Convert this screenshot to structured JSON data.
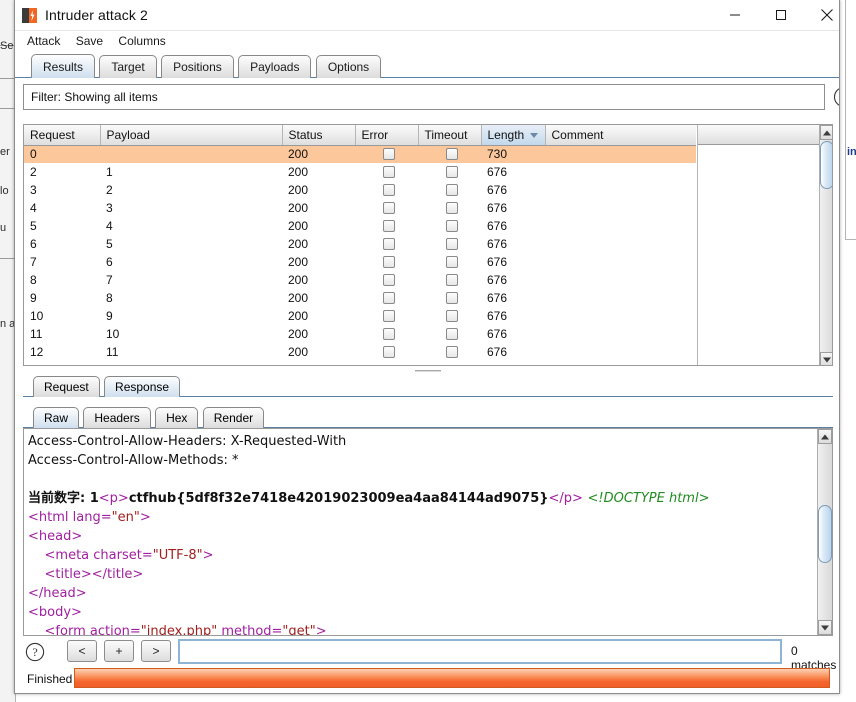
{
  "window": {
    "title": "Intruder attack 2",
    "icon": "burp-logo-icon",
    "controls": {
      "minimize": "minimize-icon",
      "maximize": "maximize-icon",
      "close": "close-icon"
    }
  },
  "menubar": {
    "items": [
      "Attack",
      "Save",
      "Columns"
    ]
  },
  "tabs": {
    "items": [
      "Results",
      "Target",
      "Positions",
      "Payloads",
      "Options"
    ],
    "active": "Results"
  },
  "filter": {
    "text": "Filter: Showing all items",
    "help": "?"
  },
  "results_table": {
    "columns": [
      "Request",
      "Payload",
      "Status",
      "Error",
      "Timeout",
      "Length",
      "Comment"
    ],
    "sorted_column": "Length",
    "sort_direction": "descending",
    "rows": [
      {
        "request": "0",
        "payload": "",
        "status": "200",
        "error": false,
        "timeout": false,
        "length": "730",
        "comment": "",
        "selected": true
      },
      {
        "request": "2",
        "payload": "1",
        "status": "200",
        "error": false,
        "timeout": false,
        "length": "676",
        "comment": "",
        "selected": false
      },
      {
        "request": "3",
        "payload": "2",
        "status": "200",
        "error": false,
        "timeout": false,
        "length": "676",
        "comment": "",
        "selected": false
      },
      {
        "request": "4",
        "payload": "3",
        "status": "200",
        "error": false,
        "timeout": false,
        "length": "676",
        "comment": "",
        "selected": false
      },
      {
        "request": "5",
        "payload": "4",
        "status": "200",
        "error": false,
        "timeout": false,
        "length": "676",
        "comment": "",
        "selected": false
      },
      {
        "request": "6",
        "payload": "5",
        "status": "200",
        "error": false,
        "timeout": false,
        "length": "676",
        "comment": "",
        "selected": false
      },
      {
        "request": "7",
        "payload": "6",
        "status": "200",
        "error": false,
        "timeout": false,
        "length": "676",
        "comment": "",
        "selected": false
      },
      {
        "request": "8",
        "payload": "7",
        "status": "200",
        "error": false,
        "timeout": false,
        "length": "676",
        "comment": "",
        "selected": false
      },
      {
        "request": "9",
        "payload": "8",
        "status": "200",
        "error": false,
        "timeout": false,
        "length": "676",
        "comment": "",
        "selected": false
      },
      {
        "request": "10",
        "payload": "9",
        "status": "200",
        "error": false,
        "timeout": false,
        "length": "676",
        "comment": "",
        "selected": false
      },
      {
        "request": "11",
        "payload": "10",
        "status": "200",
        "error": false,
        "timeout": false,
        "length": "676",
        "comment": "",
        "selected": false
      },
      {
        "request": "12",
        "payload": "11",
        "status": "200",
        "error": false,
        "timeout": false,
        "length": "676",
        "comment": "",
        "selected": false
      }
    ]
  },
  "message_tabs": {
    "items": [
      "Request",
      "Response"
    ],
    "active": "Response"
  },
  "view_tabs": {
    "items": [
      "Raw",
      "Headers",
      "Hex",
      "Render"
    ],
    "active": "Raw"
  },
  "response": {
    "lines": [
      {
        "type": "header",
        "text": "Access-Control-Allow-Headers: X-Requested-With"
      },
      {
        "type": "header",
        "text": "Access-Control-Allow-Methods: *"
      },
      {
        "type": "blank",
        "text": ""
      },
      {
        "type": "flag",
        "text": "当前数字: 1<p>ctfhub{5df8f32e7418e42019023009ea4aa84144ad9075}</p> <!DOCTYPE html>"
      },
      {
        "type": "code",
        "text": "<html lang=\"en\">"
      },
      {
        "type": "code",
        "text": "<head>"
      },
      {
        "type": "code",
        "text": "    <meta charset=\"UTF-8\">"
      },
      {
        "type": "code",
        "text": "    <title></title>"
      },
      {
        "type": "code",
        "text": "</head>"
      },
      {
        "type": "code",
        "text": "<body>"
      },
      {
        "type": "code",
        "text": "    <form action=\"index.php\" method=\"get\">"
      }
    ]
  },
  "search": {
    "help": "?",
    "prev_label": "<",
    "plus_label": "+",
    "next_label": ">",
    "value": "",
    "placeholder": "",
    "matches": "0 matches"
  },
  "status": {
    "label": "Finished",
    "progress_percent": 100
  },
  "colors": {
    "selection_orange": "#fcc79a",
    "progress_orange": "#f4652d",
    "tab_active_blue": "#cfdfee",
    "tag_purple": "#a020a0",
    "attr_red": "#a02020",
    "comment_green": "#228b22"
  },
  "background_window": {
    "left_fragments": [
      "Se",
      "er",
      "lo",
      "u",
      "n a"
    ],
    "right_fragments": [
      "in"
    ]
  }
}
